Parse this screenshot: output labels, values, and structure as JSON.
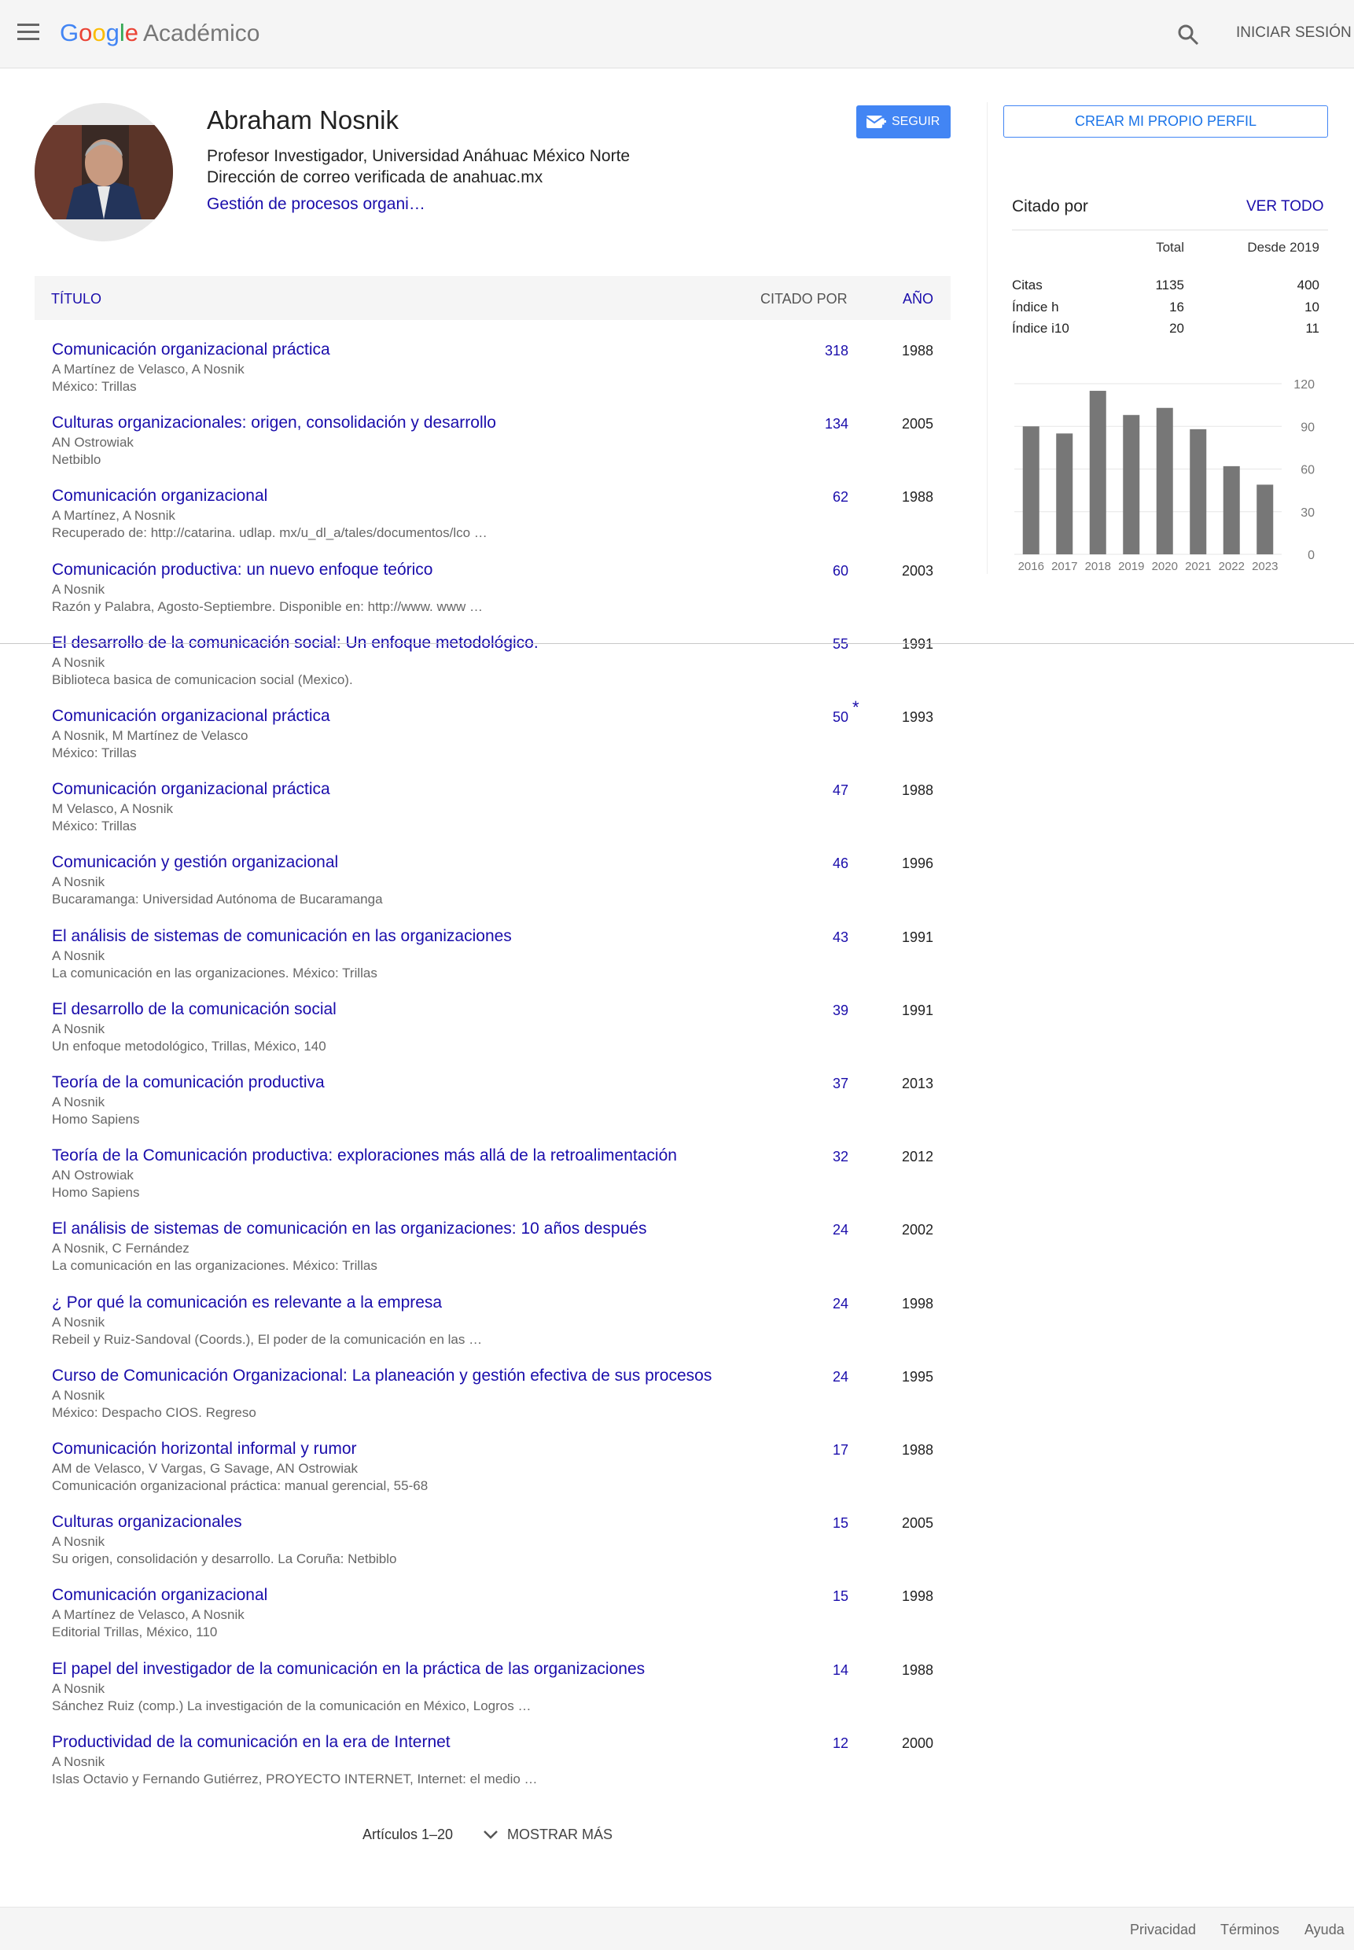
{
  "header": {
    "logo_parts": [
      "G",
      "o",
      "o",
      "g",
      "l",
      "e"
    ],
    "logo_suffix": "Académico",
    "signin": "INICIAR SESIÓN"
  },
  "profile": {
    "name": "Abraham Nosnik",
    "affiliation": "Profesor Investigador, Universidad Anáhuac México Norte",
    "email": "Dirección de correo verificada de anahuac.mx",
    "interests": "Gestión de procesos organi…",
    "follow": "SEGUIR",
    "create_profile": "CREAR MI PROPIO PERFIL"
  },
  "table": {
    "col_title": "TÍTULO",
    "col_cited": "CITADO POR",
    "col_year": "AÑO",
    "rows": [
      {
        "title": "Comunicación organizacional práctica",
        "authors": "A Martínez de Velasco, A Nosnik",
        "venue": "México: Trillas",
        "cited": "318",
        "year": "1988"
      },
      {
        "title": "Culturas organizacionales: origen, consolidación y desarrollo",
        "authors": "AN Ostrowiak",
        "venue": "Netbiblo",
        "cited": "134",
        "year": "2005"
      },
      {
        "title": "Comunicación organizacional",
        "authors": "A Martínez, A Nosnik",
        "venue": "Recuperado de: http://catarina. udlap. mx/u_dl_a/tales/documentos/lco …",
        "cited": "62",
        "year": "1988"
      },
      {
        "title": "Comunicación productiva: un nuevo enfoque teórico",
        "authors": "A Nosnik",
        "venue": "Razón y Palabra, Agosto-Septiembre. Disponible en: http://www. www …",
        "cited": "60",
        "year": "2003"
      },
      {
        "title": "El desarrollo de la comunicación social: Un enfoque metodológico.",
        "authors": "A Nosnik",
        "venue": "Biblioteca basica de comunicacion social (Mexico).",
        "cited": "55",
        "year": "1991"
      },
      {
        "title": "Comunicación organizacional práctica",
        "authors": "A Nosnik, M Martínez de Velasco",
        "venue": "México: Trillas",
        "cited": "50",
        "year": "1993",
        "star": "*"
      },
      {
        "title": "Comunicación organizacional práctica",
        "authors": "M Velasco, A Nosnik",
        "venue": "México: Trillas",
        "cited": "47",
        "year": "1988"
      },
      {
        "title": "Comunicación y gestión organizacional",
        "authors": "A Nosnik",
        "venue": "Bucaramanga: Universidad Autónoma de Bucaramanga",
        "cited": "46",
        "year": "1996"
      },
      {
        "title": "El análisis de sistemas de comunicación en las organizaciones",
        "authors": "A Nosnik",
        "venue": "La comunicación en las organizaciones. México: Trillas",
        "cited": "43",
        "year": "1991"
      },
      {
        "title": "El desarrollo de la comunicación social",
        "authors": "A Nosnik",
        "venue": "Un enfoque metodológico, Trillas, México, 140",
        "cited": "39",
        "year": "1991"
      },
      {
        "title": "Teoría de la comunicación productiva",
        "authors": "A Nosnik",
        "venue": "Homo Sapiens",
        "cited": "37",
        "year": "2013"
      },
      {
        "title": "Teoría de la Comunicación productiva: exploraciones más allá de la retroalimentación",
        "authors": "AN Ostrowiak",
        "venue": "Homo Sapiens",
        "cited": "32",
        "year": "2012"
      },
      {
        "title": "El análisis de sistemas de comunicación en las organizaciones: 10 años después",
        "authors": "A Nosnik, C Fernández",
        "venue": "La comunicación en las organizaciones. México: Trillas",
        "cited": "24",
        "year": "2002"
      },
      {
        "title": "¿ Por qué la comunicación es relevante a la empresa",
        "authors": "A Nosnik",
        "venue": "Rebeil y Ruiz-Sandoval (Coords.), El poder de la comunicación en las …",
        "cited": "24",
        "year": "1998"
      },
      {
        "title": "Curso de Comunicación Organizacional: La planeación y gestión efectiva de sus procesos",
        "authors": "A Nosnik",
        "venue": "México: Despacho CIOS. Regreso",
        "cited": "24",
        "year": "1995"
      },
      {
        "title": "Comunicación horizontal informal y rumor",
        "authors": "AM de Velasco, V Vargas, G Savage, AN Ostrowiak",
        "venue": "Comunicación organizacional práctica: manual gerencial, 55-68",
        "cited": "17",
        "year": "1988"
      },
      {
        "title": "Culturas organizacionales",
        "authors": "A Nosnik",
        "venue": "Su origen, consolidación y desarrollo. La Coruña: Netbiblo",
        "cited": "15",
        "year": "2005"
      },
      {
        "title": "Comunicación organizacional",
        "authors": "A Martínez de Velasco, A Nosnik",
        "venue": "Editorial Trillas, México, 110",
        "cited": "15",
        "year": "1998"
      },
      {
        "title": "El papel del investigador de la comunicación en la práctica de las organizaciones",
        "authors": "A Nosnik",
        "venue": "Sánchez Ruiz (comp.) La investigación de la comunicación en México, Logros …",
        "cited": "14",
        "year": "1988"
      },
      {
        "title": "Productividad de la comunicación en la era de Internet",
        "authors": "A Nosnik",
        "venue": "Islas Octavio y Fernando Gutiérrez, PROYECTO INTERNET, Internet: el medio …",
        "cited": "12",
        "year": "2000"
      }
    ],
    "pager": "Artículos 1–20",
    "show_more": "MOSTRAR MÁS"
  },
  "sidebar": {
    "cited_by": "Citado por",
    "view_all": "VER TODO",
    "col_total": "Total",
    "col_since": "Desde 2019",
    "stats": [
      {
        "label": "Citas",
        "total": "1135",
        "since": "400"
      },
      {
        "label": "Índice h",
        "total": "16",
        "since": "10"
      },
      {
        "label": "Índice i10",
        "total": "20",
        "since": "11"
      }
    ]
  },
  "chart_data": {
    "type": "bar",
    "categories": [
      "2016",
      "2017",
      "2018",
      "2019",
      "2020",
      "2021",
      "2022",
      "2023"
    ],
    "values": [
      90,
      85,
      115,
      98,
      103,
      88,
      62,
      49
    ],
    "y_ticks": [
      "0",
      "30",
      "60",
      "90",
      "120"
    ],
    "ylim": [
      0,
      120
    ],
    "bar_color": "#777777"
  },
  "footer": {
    "privacy": "Privacidad",
    "terms": "Términos",
    "help": "Ayuda"
  },
  "colors": {
    "link": "#1a0dab",
    "accent": "#4285f4"
  }
}
